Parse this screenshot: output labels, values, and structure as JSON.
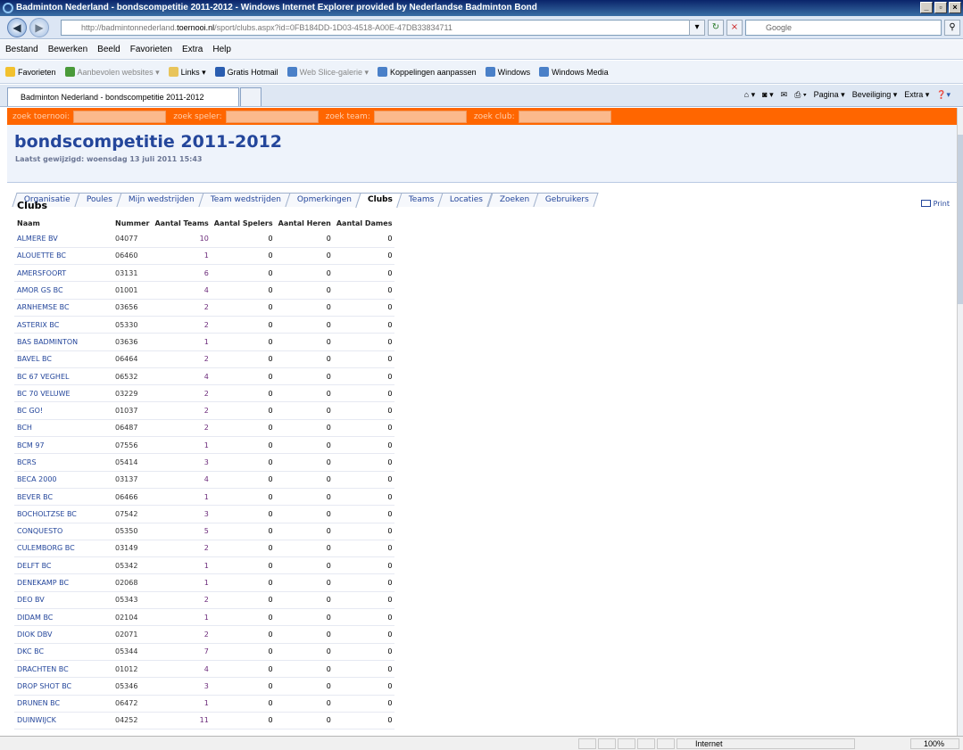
{
  "window": {
    "title": "Badminton Nederland - bondscompetitie 2011-2012 - Windows Internet Explorer provided by Nederlandse Badminton Bond"
  },
  "address": {
    "url_prefix": "http://badmintonnederland.",
    "url_host": "toernooi.nl",
    "url_suffix": "/sport/clubs.aspx?id=0FB184DD-1D03-4518-A00E-47DB33834711",
    "search_placeholder": "Google"
  },
  "menu": [
    "Bestand",
    "Bewerken",
    "Beeld",
    "Favorieten",
    "Extra",
    "Help"
  ],
  "favorites": {
    "favorites_label": "Favorieten",
    "items": [
      "Aanbevolen websites ▾",
      "Links ▾",
      "Gratis Hotmail",
      "Web Slice-galerie ▾",
      "Koppelingen aanpassen",
      "Windows",
      "Windows Media"
    ]
  },
  "browser_tab": {
    "label": "Badminton Nederland - bondscompetitie 2011-2012"
  },
  "commandbar": {
    "pagina": "Pagina ▾",
    "beveiliging": "Beveiliging ▾",
    "extra": "Extra ▾"
  },
  "search": {
    "tournament_label": "zoek toernooi:",
    "player_label": "zoek speler:",
    "team_label": "zoek team:",
    "club_label": "zoek club:"
  },
  "header": {
    "title": "bondscompetitie 2011-2012",
    "modified": "Laatst gewijzigd: woensdag 13 juli 2011 15:43"
  },
  "tabs": [
    "Organisatie",
    "Poules",
    "Mijn wedstrijden",
    "Team wedstrijden",
    "Opmerkingen",
    "Clubs",
    "Teams",
    "Locaties",
    "Zoeken",
    "Gebruikers"
  ],
  "active_tab": "Clubs",
  "page": {
    "title": "Clubs",
    "print_label": "Print"
  },
  "table": {
    "columns": [
      "Naam",
      "Nummer",
      "Aantal Teams",
      "Aantal Spelers",
      "Aantal Heren",
      "Aantal Dames"
    ],
    "rows": [
      [
        "ALMERE BV",
        "04077",
        "10",
        "0",
        "0",
        "0"
      ],
      [
        "ALOUETTE BC",
        "06460",
        "1",
        "0",
        "0",
        "0"
      ],
      [
        "AMERSFOORT",
        "03131",
        "6",
        "0",
        "0",
        "0"
      ],
      [
        "AMOR GS BC",
        "01001",
        "4",
        "0",
        "0",
        "0"
      ],
      [
        "ARNHEMSE BC",
        "03656",
        "2",
        "0",
        "0",
        "0"
      ],
      [
        "ASTERIX BC",
        "05330",
        "2",
        "0",
        "0",
        "0"
      ],
      [
        "BAS BADMINTON",
        "03636",
        "1",
        "0",
        "0",
        "0"
      ],
      [
        "BAVEL BC",
        "06464",
        "2",
        "0",
        "0",
        "0"
      ],
      [
        "BC 67 VEGHEL",
        "06532",
        "4",
        "0",
        "0",
        "0"
      ],
      [
        "BC 70 VELUWE",
        "03229",
        "2",
        "0",
        "0",
        "0"
      ],
      [
        "BC GO!",
        "01037",
        "2",
        "0",
        "0",
        "0"
      ],
      [
        "BCH",
        "06487",
        "2",
        "0",
        "0",
        "0"
      ],
      [
        "BCM 97",
        "07556",
        "1",
        "0",
        "0",
        "0"
      ],
      [
        "BCRS",
        "05414",
        "3",
        "0",
        "0",
        "0"
      ],
      [
        "BECA 2000",
        "03137",
        "4",
        "0",
        "0",
        "0"
      ],
      [
        "BEVER BC",
        "06466",
        "1",
        "0",
        "0",
        "0"
      ],
      [
        "BOCHOLTZSE BC",
        "07542",
        "3",
        "0",
        "0",
        "0"
      ],
      [
        "CONQUESTO",
        "05350",
        "5",
        "0",
        "0",
        "0"
      ],
      [
        "CULEMBORG BC",
        "03149",
        "2",
        "0",
        "0",
        "0"
      ],
      [
        "DELFT BC",
        "05342",
        "1",
        "0",
        "0",
        "0"
      ],
      [
        "DENEKAMP BC",
        "02068",
        "1",
        "0",
        "0",
        "0"
      ],
      [
        "DEO BV",
        "05343",
        "2",
        "0",
        "0",
        "0"
      ],
      [
        "DIDAM BC",
        "02104",
        "1",
        "0",
        "0",
        "0"
      ],
      [
        "DIOK DBV",
        "02071",
        "2",
        "0",
        "0",
        "0"
      ],
      [
        "DKC BC",
        "05344",
        "7",
        "0",
        "0",
        "0"
      ],
      [
        "DRACHTEN BC",
        "01012",
        "4",
        "0",
        "0",
        "0"
      ],
      [
        "DROP SHOT BC",
        "05346",
        "3",
        "0",
        "0",
        "0"
      ],
      [
        "DRUNEN BC",
        "06472",
        "1",
        "0",
        "0",
        "0"
      ],
      [
        "DUINWIJCK",
        "04252",
        "11",
        "0",
        "0",
        "0"
      ]
    ]
  },
  "status": {
    "zone": "Internet",
    "zoom": "100%"
  }
}
